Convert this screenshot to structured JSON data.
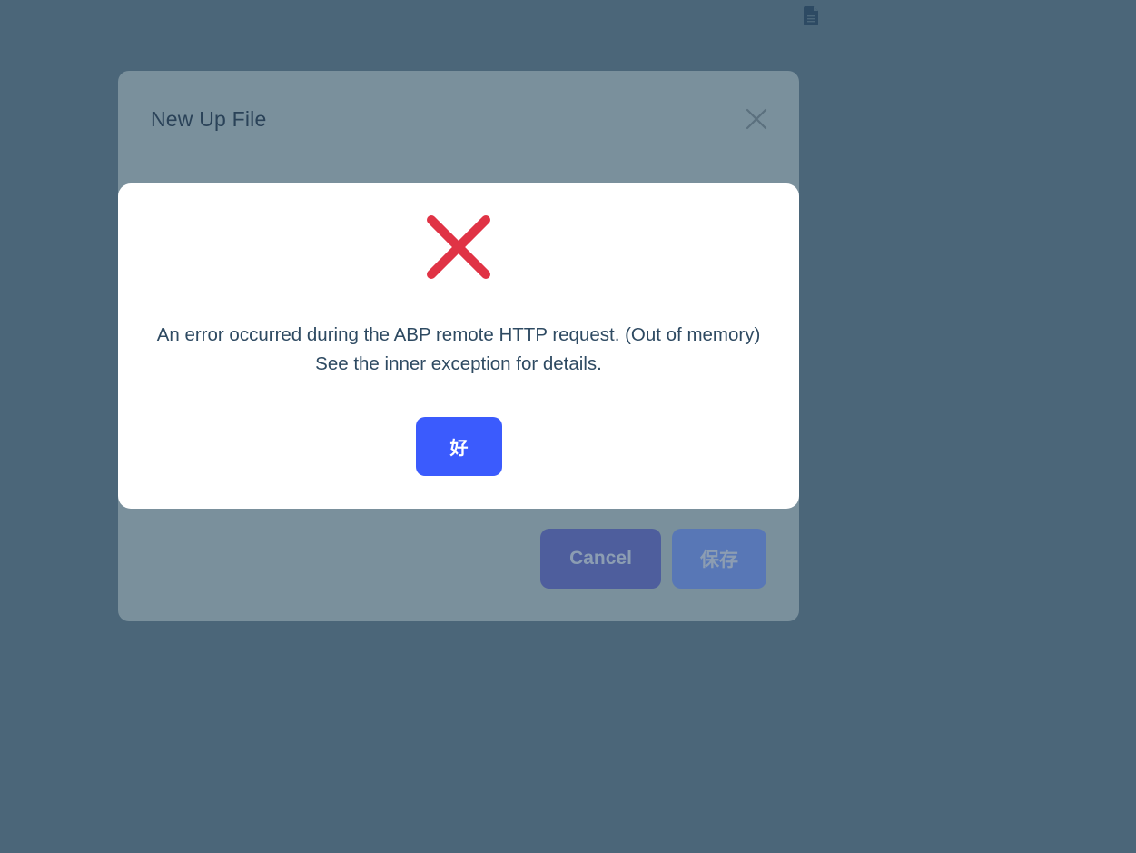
{
  "colors": {
    "backdrop": "#4b6679",
    "modal_bg": "#7a909c",
    "alert_bg": "#ffffff",
    "error_icon": "#e03345",
    "confirm_button": "#3b5bfd",
    "cancel_button": "#4e5e9d",
    "save_button": "#5877b6",
    "text_primary": "#2e4a62"
  },
  "topbar": {
    "icon": "file-document-icon"
  },
  "modal": {
    "title": "New Up File",
    "close_icon": "close-icon",
    "peek_label": "",
    "cancel_label": "Cancel",
    "save_label": "保存"
  },
  "alert": {
    "icon": "error-x-icon",
    "message": "An error occurred during the ABP remote HTTP request. (Out of memory) See the inner exception for details.",
    "confirm_label": "好"
  }
}
